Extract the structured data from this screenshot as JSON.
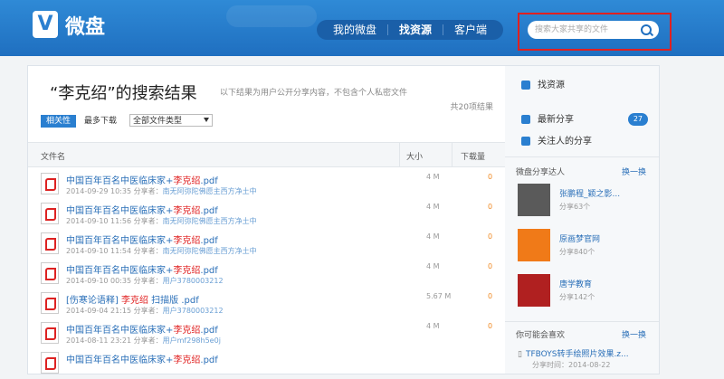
{
  "header": {
    "logo_letter": "V",
    "logo_text": "微盘",
    "nav": [
      "我的微盘",
      "找资源",
      "客户端"
    ],
    "search_placeholder": "搜索大家共享的文件"
  },
  "results": {
    "title": "“李克绍”的搜索结果",
    "subtitle": "以下结果为用户公开分享内容，不包含个人私密文件",
    "count": "共20项结果",
    "tab_relevance": "相关性",
    "tab_downloads": "最多下载",
    "filter": "全部文件类型",
    "col_name": "文件名",
    "col_size": "大小",
    "col_downloads": "下载量",
    "rows": [
      {
        "pre": "中国百年百名中医临床家+",
        "hl": "李克绍",
        "post": ".pdf",
        "date": "2014-09-29 10:35",
        "label": "分享者：",
        "user": "南无阿弥陀佛愿主西方净土中",
        "size": "4 M",
        "dl": "0"
      },
      {
        "pre": "中国百年百名中医临床家+",
        "hl": "李克绍",
        "post": ".pdf",
        "date": "2014-09-10 11:56",
        "label": "分享者：",
        "user": "南无阿弥陀佛愿主西方净土中",
        "size": "4 M",
        "dl": "0"
      },
      {
        "pre": "中国百年百名中医临床家+",
        "hl": "李克绍",
        "post": ".pdf",
        "date": "2014-09-10 11:54",
        "label": "分享者：",
        "user": "南无阿弥陀佛愿主西方净土中",
        "size": "4 M",
        "dl": "0"
      },
      {
        "pre": "中国百年百名中医临床家+",
        "hl": "李克绍",
        "post": ".pdf",
        "date": "2014-09-10 00:35",
        "label": "分享者：",
        "user": "用户3780003212",
        "size": "4 M",
        "dl": "0"
      },
      {
        "pre": "[伤寒论语释] ",
        "hl": "李克绍",
        "post": " 扫描版 .pdf",
        "date": "2014-09-04 21:15",
        "label": "分享者：",
        "user": "用户3780003212",
        "size": "5.67 M",
        "dl": "0"
      },
      {
        "pre": "中国百年百名中医临床家+",
        "hl": "李克绍",
        "post": ".pdf",
        "date": "2014-08-11 23:21",
        "label": "分享者：",
        "user": "用户mf298h5e0j",
        "size": "4 M",
        "dl": "0"
      },
      {
        "pre": "中国百年百名中医临床家+",
        "hl": "李克绍",
        "post": ".pdf",
        "date": "",
        "label": "",
        "user": "",
        "size": "",
        "dl": ""
      }
    ]
  },
  "sidebar": {
    "find": "找资源",
    "new_share": "最新分享",
    "new_count": "27",
    "follow": "关注人的分享",
    "experts_title": "微盘分享达人",
    "swap": "换一换",
    "experts": [
      {
        "name": "张鹏程_颖之影...",
        "share": "分享63个",
        "color": "#5a5a5a"
      },
      {
        "name": "原画梦官网",
        "share": "分享840个",
        "color": "#f07a18"
      },
      {
        "name": "唐学教育",
        "share": "分享142个",
        "color": "#b02020"
      }
    ],
    "like_title": "你可能会喜欢",
    "rec_title": "TFBOYS转手绘照片效果.z...",
    "rec_meta": "分享时间：2014-08-22"
  }
}
